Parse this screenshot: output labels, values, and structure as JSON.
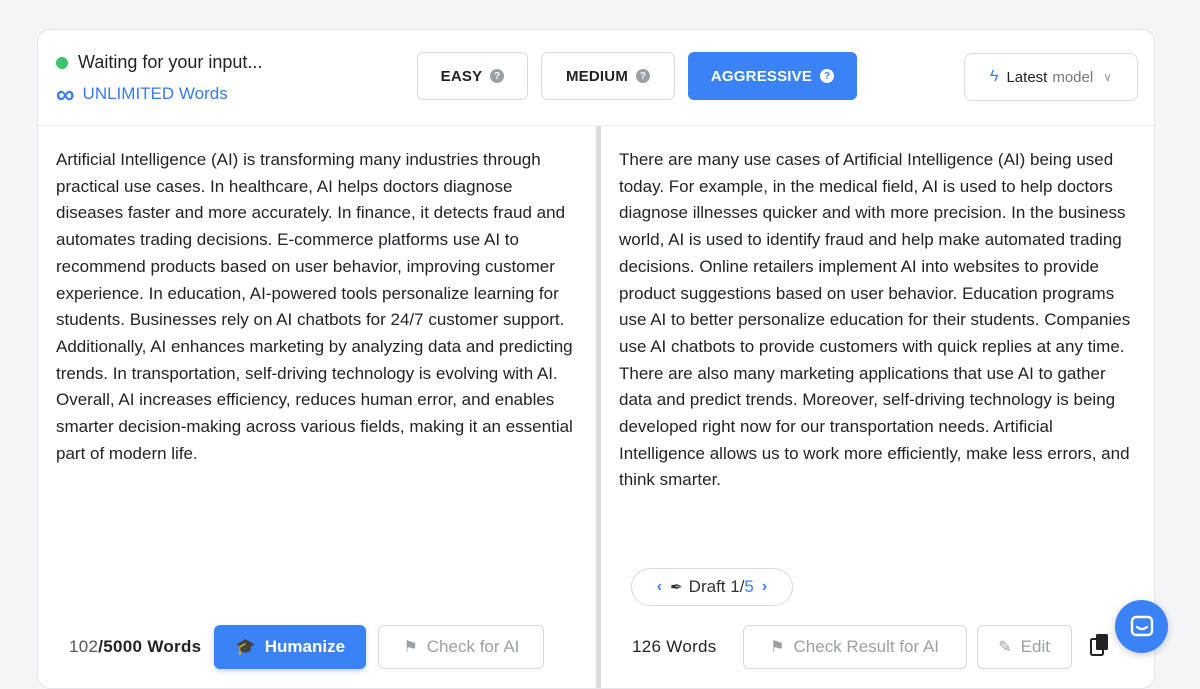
{
  "header": {
    "status_text": "Waiting for your input...",
    "unlimited_symbol": "∞",
    "unlimited_text": "UNLIMITED Words",
    "status_color": "#3ec46d",
    "accent_color": "#3b82f6"
  },
  "modes": [
    {
      "label": "EASY",
      "active": false
    },
    {
      "label": "MEDIUM",
      "active": false
    },
    {
      "label": "AGGRESSIVE",
      "active": true
    }
  ],
  "model_select": {
    "icon": "bolt-icon",
    "label": "Latest",
    "label_suffix": "model"
  },
  "input_pane": {
    "text": "Artificial Intelligence (AI) is transforming many industries through practical use cases. In healthcare, AI helps doctors diagnose diseases faster and more accurately. In finance, it detects fraud and automates trading decisions. E-commerce platforms use AI to recommend products based on user behavior, improving customer experience. In education, AI-powered tools personalize learning for students. Businesses rely on AI chatbots for 24/7 customer support. Additionally, AI enhances marketing by analyzing data and predicting trends. In transportation, self-driving technology is evolving with AI. Overall, AI increases efficiency, reduces human error, and enables smarter decision-making across various fields, making it an essential part of modern life.",
    "word_count": "102",
    "word_limit": "/5000 Words",
    "humanize_label": "Humanize",
    "check_ai_label": "Check for AI"
  },
  "output_pane": {
    "text": "There are many use cases of Artificial Intelligence (AI) being used today. For example, in the medical field, AI is used to help doctors diagnose illnesses quicker and with more precision. In the business world, AI is used to identify fraud and help make automated trading decisions. Online retailers implement AI into websites to provide product suggestions based on user behavior. Education programs use AI to better personalize education for their students. Companies use AI chatbots to provide customers with quick replies at any time. There are also many marketing applications that use AI to gather data and predict trends. Moreover, self-driving technology is being developed right now for our transportation needs. Artificial Intelligence allows us to work more efficiently, make less errors, and think smarter.",
    "draft_label": "Draft 1/",
    "draft_total": "5",
    "word_count": "126 Words",
    "check_result_label": "Check Result for AI",
    "edit_label": "Edit"
  }
}
